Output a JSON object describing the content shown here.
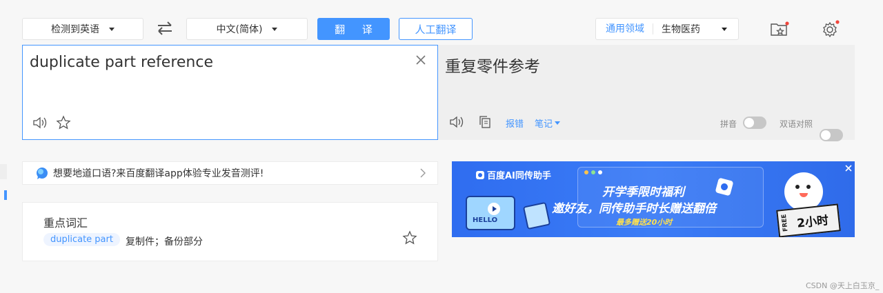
{
  "toolbar": {
    "source_lang": "检测到英语",
    "target_lang": "中文(简体)",
    "translate_label": "翻 译",
    "human_translate_label": "人工翻译",
    "domain_label": "通用领域",
    "domain_value": "生物医药"
  },
  "source": {
    "text": "duplicate part reference"
  },
  "target": {
    "text": "重复零件参考",
    "report_error": "报错",
    "notes": "笔记",
    "pinyin_label": "拼音",
    "bilingual_label": "双语对照"
  },
  "promo": {
    "text": "想要地道口语?来百度翻译app体验专业发音测评!"
  },
  "vocab": {
    "title": "重点词汇",
    "term": "duplicate part",
    "meaning": "复制件；备份部分"
  },
  "banner": {
    "brand": "百度AI同传助手",
    "headline": "开学季限时福利",
    "subline": "邀好友，同传助手时长赠送翻倍",
    "note": "最多赠送20小时",
    "free": "FREE",
    "hours": "2小时",
    "hello": "HELLO"
  },
  "watermark": "CSDN @天上白玉京_",
  "colors": {
    "accent": "#4395ff",
    "red_dot": "#f0463c"
  }
}
